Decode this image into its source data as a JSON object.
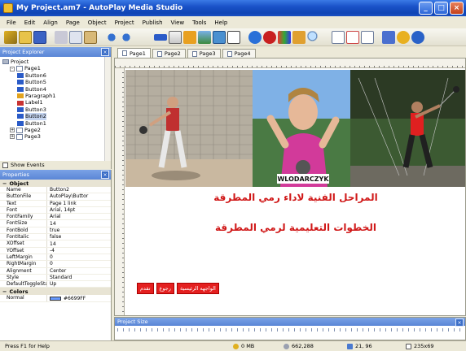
{
  "window": {
    "title": "My Project.am7 - AutoPlay Media Studio",
    "btn_min": "_",
    "btn_max": "□",
    "btn_close": "×"
  },
  "menu": [
    "File",
    "Edit",
    "Align",
    "Page",
    "Object",
    "Project",
    "Publish",
    "View",
    "Tools",
    "Help"
  ],
  "toolbar_icons": [
    "wand-icon",
    "open-icon",
    "save-icon",
    "cut-icon",
    "copy-icon",
    "paste-icon",
    "undo-icon",
    "redo-icon",
    "button-object-icon",
    "text-object-icon",
    "paragraph-object-icon",
    "image-object-icon",
    "video-object-icon",
    "flash-object-icon",
    "web-object-icon",
    "record-icon",
    "color-icon",
    "plugin-icon",
    "zoom-icon",
    "page-add-icon",
    "page-remove-icon",
    "page-props-icon",
    "build-icon",
    "preview-icon",
    "help-icon"
  ],
  "explorer": {
    "title": "Project Explorer",
    "tree": [
      {
        "label": "Project",
        "icon": "proj",
        "level": 0,
        "pm": ""
      },
      {
        "label": "Page1",
        "icon": "page",
        "level": 1,
        "pm": "-"
      },
      {
        "label": "Button6",
        "icon": "btn",
        "level": 2,
        "pm": ""
      },
      {
        "label": "Button5",
        "icon": "btn",
        "level": 2,
        "pm": ""
      },
      {
        "label": "Button4",
        "icon": "btn",
        "level": 2,
        "pm": ""
      },
      {
        "label": "Paragraph1",
        "icon": "para",
        "level": 2,
        "pm": ""
      },
      {
        "label": "Label1",
        "icon": "label",
        "level": 2,
        "pm": ""
      },
      {
        "label": "Button3",
        "icon": "btn",
        "level": 2,
        "pm": ""
      },
      {
        "label": "Button2",
        "icon": "btn",
        "level": 2,
        "pm": "",
        "selected": true
      },
      {
        "label": "Button1",
        "icon": "btn",
        "level": 2,
        "pm": ""
      },
      {
        "label": "Page2",
        "icon": "page",
        "level": 1,
        "pm": "+"
      },
      {
        "label": "Page3",
        "icon": "page",
        "level": 1,
        "pm": "+"
      }
    ],
    "show_events": "Show Events"
  },
  "properties": {
    "title": "Properties",
    "cat_object": "Object",
    "rows": [
      {
        "k": "Name",
        "v": "Button2"
      },
      {
        "k": "ButtonFile",
        "v": "AutoPlay\\Buttor"
      },
      {
        "k": "Text",
        "v": "Page 1 link"
      },
      {
        "k": "Font",
        "v": "Arial, 14pt"
      },
      {
        "k": "FontFamily",
        "v": "Arial"
      },
      {
        "k": "FontSize",
        "v": "14"
      },
      {
        "k": "FontBold",
        "v": "true"
      },
      {
        "k": "FontItalic",
        "v": "false"
      },
      {
        "k": "XOffset",
        "v": "14"
      },
      {
        "k": "YOffset",
        "v": "-4"
      },
      {
        "k": "LeftMargin",
        "v": "0"
      },
      {
        "k": "RightMargin",
        "v": "0"
      },
      {
        "k": "Alignment",
        "v": "Center"
      },
      {
        "k": "Style",
        "v": "Standard"
      },
      {
        "k": "DefaultToggleSta",
        "v": "Up"
      }
    ],
    "cat_colors": "Colors",
    "color_rows": [
      {
        "k": "Normal",
        "v": "#6699FF",
        "color": "#6699ff"
      }
    ]
  },
  "tabs": [
    "Page1",
    "Page2",
    "Page3",
    "Page4"
  ],
  "canvas": {
    "banner_name": "WLODARCZYK",
    "heading1": "المراحل الفنية لاداء رمي المطرقة",
    "heading2": "الخطوات التعليمية لرمي المطرقة",
    "buttons": [
      "الواجهه الرئيسية",
      "رجوع",
      "تقدم"
    ]
  },
  "size_panel": {
    "title": "Project Size"
  },
  "status": {
    "help": "Press F1 for Help",
    "mem": "0 MB",
    "size": "662,288",
    "coords": "21, 96",
    "dims": "235x69"
  }
}
